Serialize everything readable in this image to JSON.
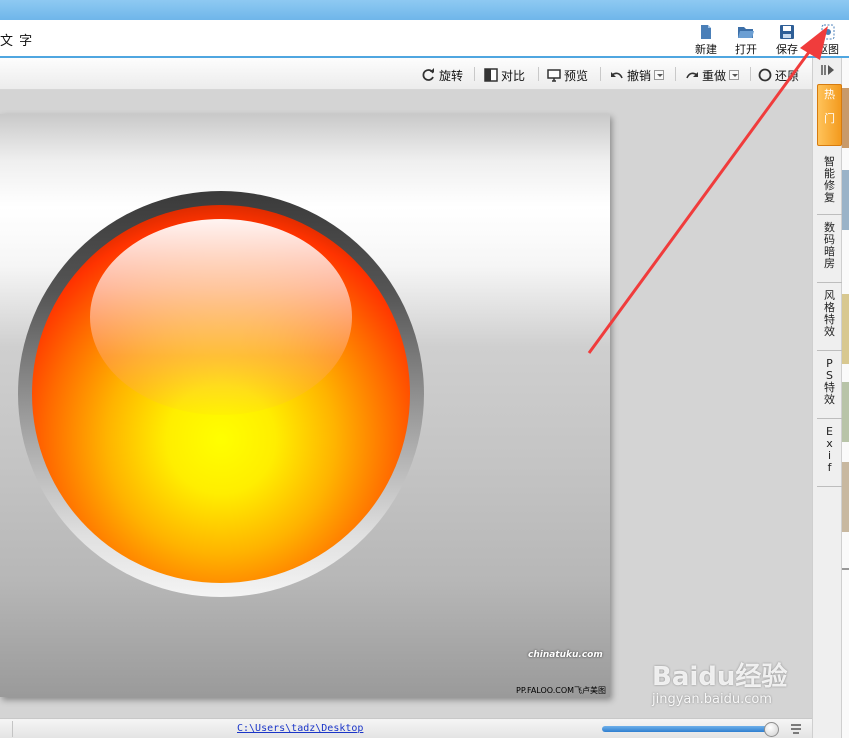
{
  "menu": {
    "partial_label": "文 字"
  },
  "main_toolbar": {
    "new_label": "新建",
    "open_label": "打开",
    "save_label": "保存",
    "cutout_label": "抠图"
  },
  "edit_toolbar": {
    "rotate_label": "旋转",
    "compare_label": "对比",
    "preview_label": "预览",
    "undo_label": "撤销",
    "redo_label": "重做",
    "restore_label": "还原"
  },
  "image": {
    "watermark_site": "chinatuku.com",
    "watermark_caption": "PP.FALOO.COM飞卢美图"
  },
  "status": {
    "path": "C:\\Users\\tadz\\Desktop",
    "zoom_fraction": 0.93
  },
  "sidebar": {
    "tabs": [
      {
        "label": "热门",
        "chars": [
          "热",
          "门"
        ]
      },
      {
        "label": "智能修复",
        "chars": [
          "智",
          "能",
          "修",
          "复"
        ]
      },
      {
        "label": "数码暗房",
        "chars": [
          "数",
          "码",
          "暗",
          "房"
        ]
      },
      {
        "label": "风格特效",
        "chars": [
          "风",
          "格",
          "特",
          "效"
        ]
      },
      {
        "label": "PS特效",
        "chars": [
          "P",
          "S",
          "特",
          "效"
        ]
      },
      {
        "label": "Exif",
        "chars": [
          "E",
          "x",
          "i",
          "f"
        ]
      }
    ]
  },
  "watermark": {
    "logo": "Baidu经验",
    "url": "jingyan.baidu.com"
  },
  "colors": {
    "accent_blue": "#4fa6e0",
    "active_tab": "#f39a1e",
    "annotation_arrow": "#f03c3c"
  }
}
